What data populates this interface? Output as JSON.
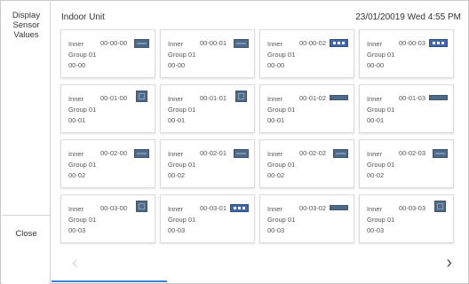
{
  "sidebar": {
    "display_sensor_values": "Display\nSensor\nValues",
    "close": "Close"
  },
  "header": {
    "title": "Indoor Unit",
    "datetime": "23/01/20019 Wed 4:55 PM"
  },
  "units": [
    {
      "name": "Inner",
      "address": "00-00-00",
      "group": "Group 01",
      "code": "00-00",
      "icon": "ceiling-unit-icon"
    },
    {
      "name": "Inner",
      "address": "00-00-01",
      "group": "Group 01",
      "code": "00-00",
      "icon": "ceiling-unit-icon"
    },
    {
      "name": "Inner",
      "address": "00-00-02",
      "group": "Group 01",
      "code": "00-00",
      "icon": "display-unit-icon"
    },
    {
      "name": "Inner",
      "address": "00-00-03",
      "group": "Group 01",
      "code": "00-00",
      "icon": "display-unit-icon"
    },
    {
      "name": "Inner",
      "address": "00-01-00",
      "group": "Group 01",
      "code": "00-01",
      "icon": "cassette-unit-icon"
    },
    {
      "name": "Inner",
      "address": "00-01-01",
      "group": "Group 01",
      "code": "00-01",
      "icon": "cassette-unit-icon"
    },
    {
      "name": "Inner",
      "address": "00-01-02",
      "group": "Group 01",
      "code": "00-01",
      "icon": "wall-unit-icon"
    },
    {
      "name": "Inner",
      "address": "00-01-03",
      "group": "Group 01",
      "code": "00-01",
      "icon": "wall-unit-icon"
    },
    {
      "name": "Inner",
      "address": "00-02-00",
      "group": "Group 01",
      "code": "00-02",
      "icon": "ceiling-unit-icon"
    },
    {
      "name": "Inner",
      "address": "00-02-01",
      "group": "Group 01",
      "code": "00-02",
      "icon": "ceiling-unit-icon"
    },
    {
      "name": "Inner",
      "address": "00-02-02",
      "group": "Group 01",
      "code": "00-02",
      "icon": "ceiling-unit-icon"
    },
    {
      "name": "Inner",
      "address": "00-02-03",
      "group": "Group 01",
      "code": "00-02",
      "icon": "ceiling-unit-icon"
    },
    {
      "name": "Inner",
      "address": "00-03-00",
      "group": "Group 01",
      "code": "00-03",
      "icon": "cassette-unit-icon"
    },
    {
      "name": "Inner",
      "address": "00-03-01",
      "group": "Group 01",
      "code": "00-03",
      "icon": "display-unit-icon"
    },
    {
      "name": "Inner",
      "address": "00-03-02",
      "group": "Group 01",
      "code": "00-03",
      "icon": "wall-unit-icon"
    },
    {
      "name": "Inner",
      "address": "00-03-03",
      "group": "Group 01",
      "code": "00-03",
      "icon": "cassette-unit-icon"
    }
  ],
  "pager": {
    "prev_icon": "chevron-left-icon",
    "next_icon": "chevron-right-icon",
    "prev_glyph": "‹",
    "next_glyph": "›"
  },
  "colors": {
    "accent": "#3b82d6",
    "icon_blue": "#4f6a88",
    "display_blue": "#3f66a8"
  }
}
